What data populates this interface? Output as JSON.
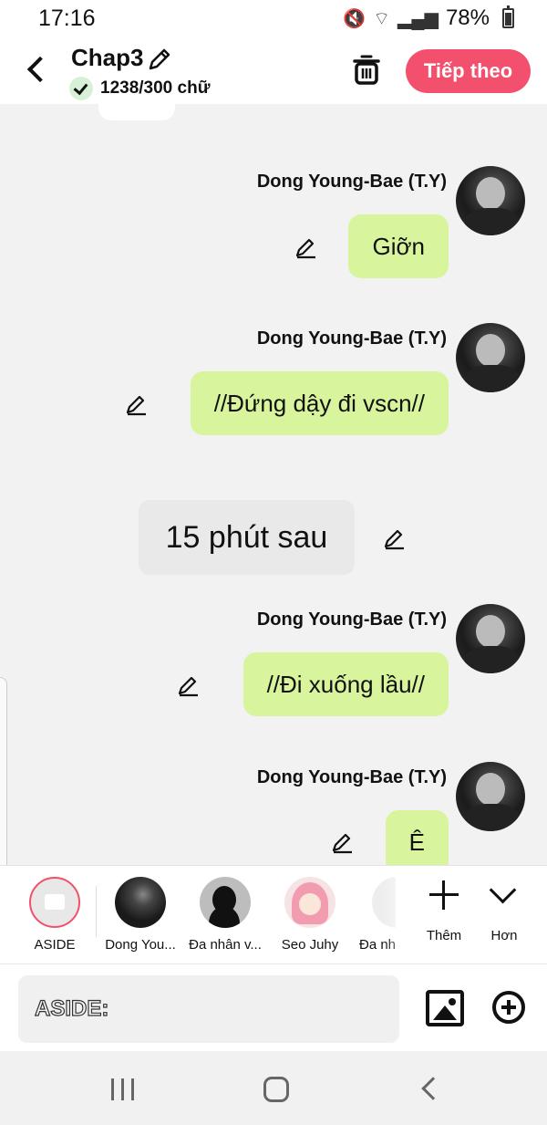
{
  "status_bar": {
    "time": "17:16",
    "battery": "78%"
  },
  "header": {
    "title": "Chap3",
    "word_count": "1238/300 chữ",
    "next_label": "Tiếp theo"
  },
  "messages": [
    {
      "sender": "Dong Young-Bae (T.Y)",
      "text": "Giỡn"
    },
    {
      "sender": "Dong Young-Bae (T.Y)",
      "text": "//Đứng dậy đi vscn//"
    },
    {
      "sender": "Dong Young-Bae (T.Y)",
      "text": "//Đi xuống lầu//"
    },
    {
      "sender": "Dong Young-Bae (T.Y)",
      "text": "Ê"
    }
  ],
  "narration": {
    "text": "15 phút sau"
  },
  "characters": [
    {
      "name": "ASIDE"
    },
    {
      "name": "Dong You..."
    },
    {
      "name": "Đa nhân v..."
    },
    {
      "name": "Seo Juhy"
    },
    {
      "name": "Đa nh"
    }
  ],
  "actions": {
    "add_label": "Thêm",
    "more_label": "Hơn"
  },
  "input": {
    "placeholder": "ASIDE:"
  },
  "icons": {
    "back": "back-arrow-icon",
    "edit": "pencil-icon",
    "trash": "trash-icon",
    "check": "check-icon",
    "image": "image-icon",
    "add": "add-circle-icon"
  },
  "colors": {
    "accent": "#f2506c",
    "bubble": "#d8f59e",
    "narration_bg": "#e9e9e9"
  }
}
